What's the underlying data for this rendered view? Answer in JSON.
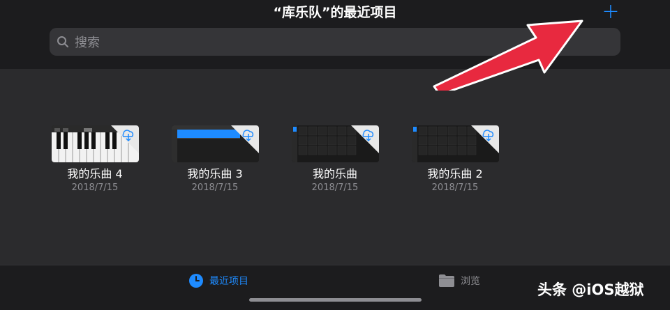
{
  "header": {
    "title": "“库乐队”的最近项目",
    "add_label": "+"
  },
  "search": {
    "placeholder": "搜索"
  },
  "documents": [
    {
      "name": "我的乐曲 4",
      "date": "2018/7/15",
      "thumbnail": "keyboard"
    },
    {
      "name": "我的乐曲 3",
      "date": "2018/7/15",
      "thumbnail": "tracks"
    },
    {
      "name": "我的乐曲",
      "date": "2018/7/15",
      "thumbnail": "live-loops"
    },
    {
      "name": "我的乐曲 2",
      "date": "2018/7/15",
      "thumbnail": "live-loops"
    }
  ],
  "tabbar": {
    "tabs": [
      {
        "label": "最近项目",
        "icon": "clock-icon",
        "active": true
      },
      {
        "label": "浏览",
        "icon": "folder-icon",
        "active": false
      }
    ]
  },
  "watermark": "头条 @iOS越狱",
  "colors": {
    "accent": "#1e8bff",
    "background": "#2b2b2d",
    "bar": "#1c1c1e",
    "annotation_arrow": "#e8293f"
  }
}
